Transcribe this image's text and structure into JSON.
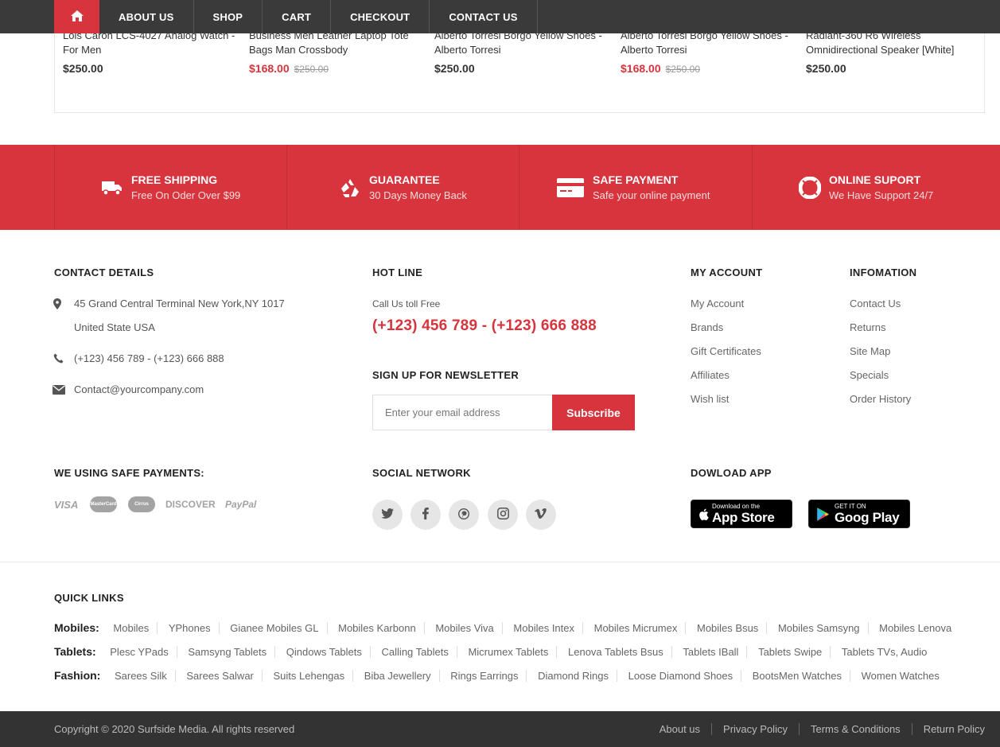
{
  "nav": {
    "items": [
      "ABOUT US",
      "SHOP",
      "CART",
      "CHECKOUT",
      "CONTACT US"
    ]
  },
  "products": [
    {
      "name": "Lois Caron LCS-4027 Analog Watch - For Men",
      "price": "$250.00",
      "old_price": ""
    },
    {
      "name": "Business Men Leather Laptop Tote Bags Man Crossbody",
      "price": "$168.00",
      "old_price": "$250.00"
    },
    {
      "name": "Alberto Torresi Borgo Yellow Shoes - Alberto Torresi",
      "price": "$250.00",
      "old_price": ""
    },
    {
      "name": "Alberto Torresi Borgo Yellow Shoes - Alberto Torresi",
      "price": "$168.00",
      "old_price": "$250.00"
    },
    {
      "name": "Radiant-360 R6 Wireless Omnidirectional Speaker [White]",
      "price": "$250.00",
      "old_price": ""
    }
  ],
  "services": [
    {
      "title": "FREE SHIPPING",
      "sub": "Free On Oder Over $99",
      "icon": "truck-icon"
    },
    {
      "title": "GUARANTEE",
      "sub": "30 Days Money Back",
      "icon": "recycle-icon"
    },
    {
      "title": "SAFE PAYMENT",
      "sub": "Safe your online payment",
      "icon": "credit-card-icon"
    },
    {
      "title": "ONLINE SUPORT",
      "sub": "We Have Support 24/7",
      "icon": "life-ring-icon"
    }
  ],
  "contact": {
    "heading": "CONTACT DETAILS",
    "address1": "45 Grand Central Terminal New York,NY 1017",
    "address2": "United State USA",
    "phone": "(+123) 456 789 - (+123) 666 888",
    "email": "Contact@yourcompany.com"
  },
  "hotline": {
    "heading": "HOT LINE",
    "label": "Call Us toll Free",
    "number": "(+123) 456 789 - (+123) 666 888"
  },
  "newsletter": {
    "heading": "SIGN UP FOR NEWSLETTER",
    "placeholder": "Enter your email address",
    "button": "Subscribe"
  },
  "my_account": {
    "heading": "MY ACCOUNT",
    "links": [
      "My Account",
      "Brands",
      "Gift Certificates",
      "Affiliates",
      "Wish list"
    ]
  },
  "information": {
    "heading": "INFOMATION",
    "links": [
      "Contact Us",
      "Returns",
      "Site Map",
      "Specials",
      "Order History"
    ]
  },
  "payments": {
    "heading": "WE USING SAFE PAYMENTS:",
    "methods": [
      "VISA",
      "MasterCard",
      "Cirrus",
      "DISCOVER",
      "PayPal"
    ]
  },
  "social": {
    "heading": "SOCIAL NETWORK",
    "icons": [
      "twitter-icon",
      "facebook-icon",
      "pinterest-icon",
      "instagram-icon",
      "vimeo-icon"
    ]
  },
  "app": {
    "heading": "DOWLOAD APP",
    "appstore_small": "Download on the",
    "appstore_big": "App Store",
    "gplay_small": "GET IT ON",
    "gplay_big": "Goog Play"
  },
  "quick_links": {
    "heading": "QUICK LINKS",
    "rows": [
      {
        "label": "Mobiles:",
        "items": [
          "Mobiles",
          "YPhones",
          "Gianee Mobiles GL",
          "Mobiles Karbonn",
          "Mobiles Viva",
          "Mobiles Intex",
          "Mobiles Micrumex",
          "Mobiles Bsus",
          "Mobiles Samsyng",
          "Mobiles Lenova"
        ]
      },
      {
        "label": "Tablets:",
        "items": [
          "Plesc YPads",
          "Samsyng Tablets",
          "Qindows Tablets",
          "Calling Tablets",
          "Micrumex Tablets",
          "Lenova Tablets Bsus",
          "Tablets IBall",
          "Tablets Swipe",
          "Tablets TVs, Audio"
        ]
      },
      {
        "label": "Fashion:",
        "items": [
          "Sarees Silk",
          "Sarees Salwar",
          "Suits Lehengas",
          "Biba Jewellery",
          "Rings Earrings",
          "Diamond Rings",
          "Loose Diamond Shoes",
          "BootsMen Watches",
          "Women Watches"
        ]
      }
    ]
  },
  "bottom": {
    "copyright": "Copyright © 2020 Surfside Media. All rights reserved",
    "links": [
      "About us",
      "Privacy Policy",
      "Terms & Conditions",
      "Return Policy"
    ]
  },
  "colors": {
    "accent": "#d7343d",
    "nav_bg": "#3a3a3a",
    "bottom_bg": "#333333"
  }
}
